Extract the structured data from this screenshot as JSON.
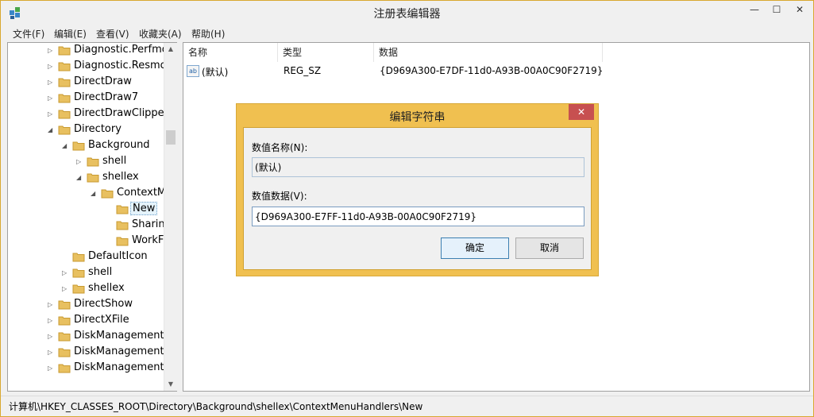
{
  "window": {
    "title": "注册表编辑器",
    "min_icon": "—",
    "max_icon": "☐",
    "close_icon": "✕"
  },
  "menu": [
    "文件(F)",
    "编辑(E)",
    "查看(V)",
    "收藏夹(A)",
    "帮助(H)"
  ],
  "tree": {
    "items": [
      {
        "label": "Diagnostic.Perfmon",
        "expander": "▷"
      },
      {
        "label": "Diagnostic.Resmon.",
        "expander": "▷"
      },
      {
        "label": "DirectDraw",
        "expander": "▷"
      },
      {
        "label": "DirectDraw7",
        "expander": "▷"
      },
      {
        "label": "DirectDrawClipper",
        "expander": "▷"
      },
      {
        "label": "Directory",
        "expander": "◢"
      },
      {
        "label": "Background",
        "expander": "◢"
      },
      {
        "label": "shell",
        "expander": "▷"
      },
      {
        "label": "shellex",
        "expander": "◢"
      },
      {
        "label": "ContextM",
        "expander": "◢"
      },
      {
        "label": "New",
        "expander": ""
      },
      {
        "label": "Sharing",
        "expander": ""
      },
      {
        "label": "WorkF",
        "expander": ""
      },
      {
        "label": "DefaultIcon",
        "expander": ""
      },
      {
        "label": "shell",
        "expander": "▷"
      },
      {
        "label": "shellex",
        "expander": "▷"
      },
      {
        "label": "DirectShow",
        "expander": "▷"
      },
      {
        "label": "DirectXFile",
        "expander": "▷"
      },
      {
        "label": "DiskManagement.C",
        "expander": "▷"
      },
      {
        "label": "DiskManagement.C",
        "expander": "▷"
      },
      {
        "label": "DiskManagement.D",
        "expander": "▷"
      }
    ],
    "scroll_up": "▲",
    "scroll_down": "▼"
  },
  "list": {
    "headers": [
      "名称",
      "类型",
      "数据"
    ],
    "rows": [
      {
        "icon_text": "ab",
        "name": "(默认)",
        "type": "REG_SZ",
        "data": "{D969A300-E7DF-11d0-A93B-00A0C90F2719}"
      }
    ]
  },
  "dialog": {
    "title": "编辑字符串",
    "close_icon": "✕",
    "name_label": "数值名称(N):",
    "name_value": "(默认)",
    "data_label": "数值数据(V):",
    "data_value": "{D969A300-E7FF-11d0-A93B-00A0C90F2719}",
    "ok": "确定",
    "cancel": "取消"
  },
  "status": {
    "path": "计算机\\HKEY_CLASSES_ROOT\\Directory\\Background\\shellex\\ContextMenuHandlers\\New"
  },
  "colors": {
    "accent_border": "#f0c050",
    "close_button": "#c75050",
    "selection": "#e5f3fb"
  }
}
